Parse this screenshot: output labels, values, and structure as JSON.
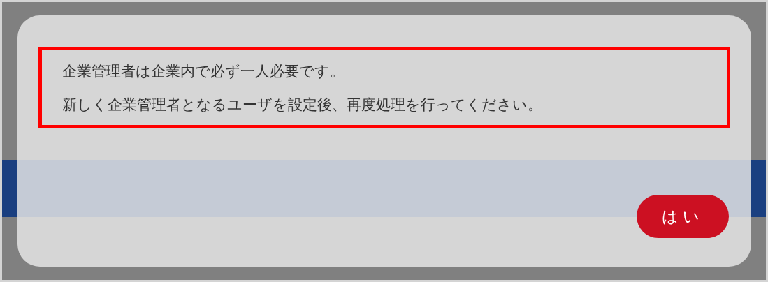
{
  "dialog": {
    "message_lines": [
      "企業管理者は企業内で必ず一人必要です。",
      "新しく企業管理者となるユーザを設定後、再度処理を行ってください。"
    ],
    "buttons": [
      {
        "label": "はい"
      }
    ]
  }
}
